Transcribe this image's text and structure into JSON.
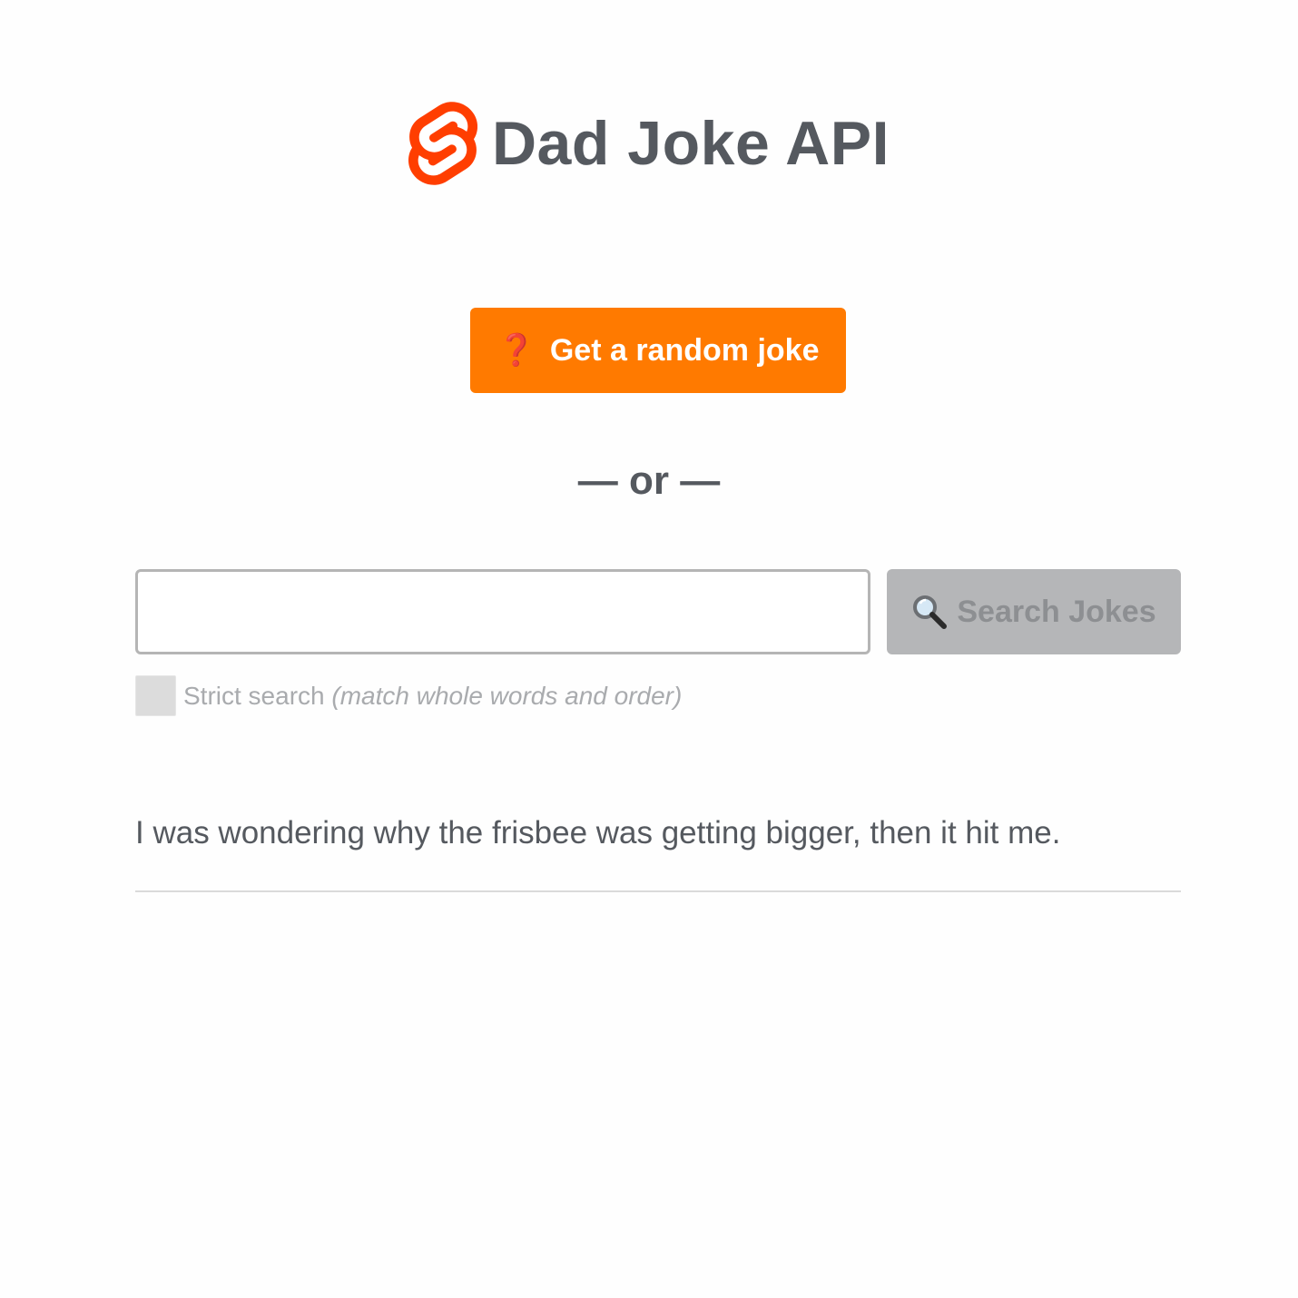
{
  "header": {
    "logo_icon": "svelte-logo-icon",
    "title": "Dad Joke API",
    "brand_color": "#ff3e00"
  },
  "random": {
    "icon": "question-mark-icon",
    "icon_glyph": "❓",
    "label": "Get a random joke",
    "color": "#ff7a00"
  },
  "divider": {
    "label": "— or —"
  },
  "search": {
    "value": "",
    "placeholder": "",
    "button_icon": "magnifying-glass-icon",
    "button_label": "Search Jokes",
    "button_disabled": true
  },
  "strict": {
    "checked": false,
    "label": "Strict search ",
    "hint": "(match whole words and order)"
  },
  "jokes": [
    {
      "text": "I was wondering why the frisbee was getting bigger, then it hit me."
    }
  ]
}
